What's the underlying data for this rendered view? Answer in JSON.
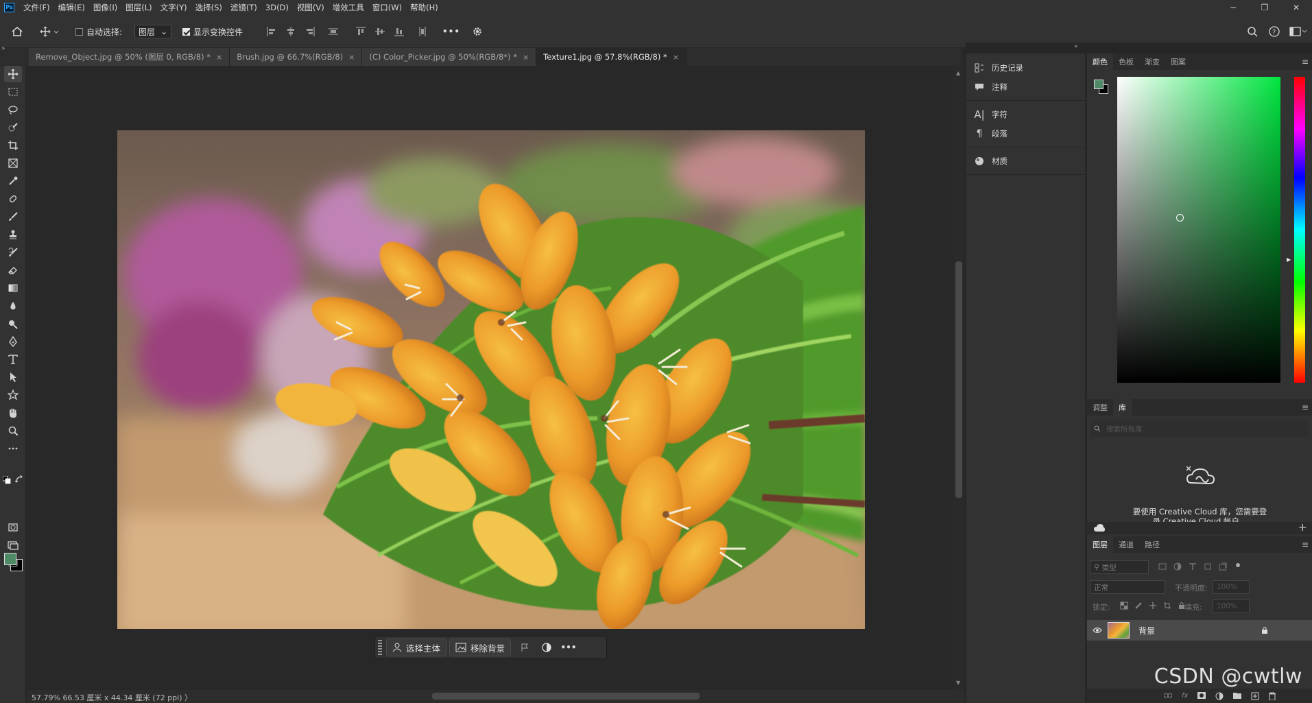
{
  "app": {
    "logo": "Ps"
  },
  "menubar": {
    "items": [
      "文件(F)",
      "编辑(E)",
      "图像(I)",
      "图层(L)",
      "文字(Y)",
      "选择(S)",
      "滤镜(T)",
      "3D(D)",
      "视图(V)",
      "增效工具",
      "窗口(W)",
      "帮助(H)"
    ],
    "window_controls": {
      "minimize": "─",
      "restore": "❐",
      "close": "✕"
    }
  },
  "options_bar": {
    "auto_select_label": "自动选择:",
    "auto_select_checked": false,
    "auto_select_target": "图层",
    "show_transform_label": "显示变换控件",
    "show_transform_checked": true,
    "more_label": "•••"
  },
  "tabs": [
    {
      "label": "Remove_Object.jpg @ 50% (图层 0, RGB/8) *",
      "active": false
    },
    {
      "label": "Brush.jpg @ 66.7%(RGB/8)",
      "active": false
    },
    {
      "label": "(C) Color_Picker.jpg @ 50%(RGB/8*) *",
      "active": false
    },
    {
      "label": "Texture1.jpg @ 57.8%(RGB/8) *",
      "active": true
    }
  ],
  "tab_close": "×",
  "tools": [
    "move-tool",
    "marquee-tool",
    "lasso-tool",
    "quick-select-tool",
    "crop-tool",
    "frame-tool",
    "eyedropper-tool",
    "healing-brush-tool",
    "brush-tool",
    "clone-stamp-tool",
    "history-brush-tool",
    "eraser-tool",
    "gradient-tool",
    "blur-tool",
    "dodge-tool",
    "pen-tool",
    "type-tool",
    "path-select-tool",
    "shape-tool",
    "hand-tool",
    "zoom-tool",
    "more-tools"
  ],
  "colors": {
    "foreground": "#4f8a67",
    "background": "#000000",
    "accent": "#00e640"
  },
  "context_bar": {
    "select_subject": "选择主体",
    "remove_background": "移除背景",
    "more": "•••"
  },
  "statusbar": {
    "text": "57.79%  66.53 厘米 x 44.34 厘米 (72 ppi)  〉"
  },
  "mid_panel": {
    "items": [
      {
        "icon": "history-icon",
        "label": "历史记录"
      },
      {
        "icon": "comment-icon",
        "label": "注释"
      },
      {
        "icon": "character-icon",
        "label": "字符"
      },
      {
        "icon": "paragraph-icon",
        "label": "段落"
      },
      {
        "icon": "material-icon",
        "label": "材质"
      }
    ]
  },
  "color_panel": {
    "tabs": [
      "颜色",
      "色板",
      "渐变",
      "图案"
    ],
    "active": "颜色",
    "menu": "≡"
  },
  "library_panel": {
    "tabs": [
      "调整",
      "库"
    ],
    "active": "库",
    "search_placeholder": "搜索所有库",
    "message": "要使用 Creative Cloud 库，您需要登",
    "message2": "录 Creative Cloud 帐户。",
    "add": "+"
  },
  "layers_panel": {
    "tabs": [
      "图层",
      "通道",
      "路径"
    ],
    "active": "图层",
    "filter_placeholder": "类型",
    "blend_mode": "正常",
    "opacity_label": "不透明度:",
    "opacity_value": "100%",
    "lock_label": "锁定:",
    "fill_label": "填充:",
    "fill_value": "100%",
    "layers": [
      {
        "name": "背景",
        "visible": true,
        "locked": true
      }
    ],
    "bottom_icons": [
      "link-icon",
      "fx-icon",
      "mask-icon",
      "adjustment-icon",
      "folder-icon",
      "new-layer-icon",
      "trash-icon"
    ]
  },
  "watermark": "CSDN @cwtlw"
}
